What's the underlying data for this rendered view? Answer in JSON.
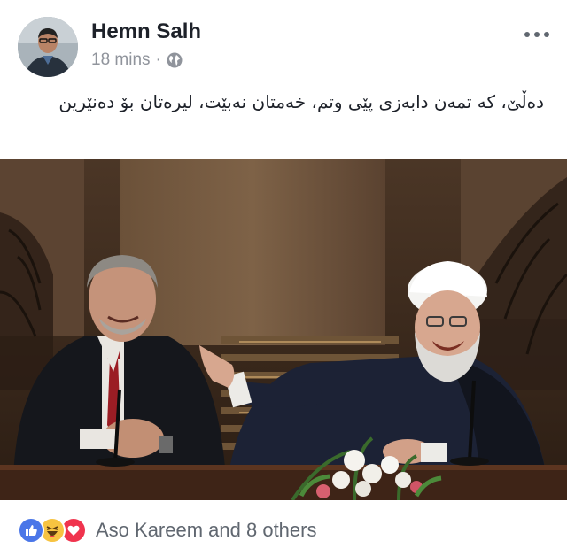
{
  "post": {
    "author": "Hemn Salh",
    "time": "18 mins",
    "separator": "·",
    "audience_icon": "globe-icon",
    "more_icon": "more-options-icon",
    "text": "دەڵێ، کە تمەن دابەزی پێی وتم، خەمتان نەبێت، لیرەتان بۆ دەنێرین",
    "photo_description_icon": "post-photo"
  },
  "reactions": {
    "icons": [
      "like-icon",
      "haha-icon",
      "love-icon"
    ],
    "summary": "Aso Kareem and 8 others",
    "colors": {
      "like": "#4a76e8",
      "haha": "#f7c341",
      "love": "#f0344e"
    }
  }
}
